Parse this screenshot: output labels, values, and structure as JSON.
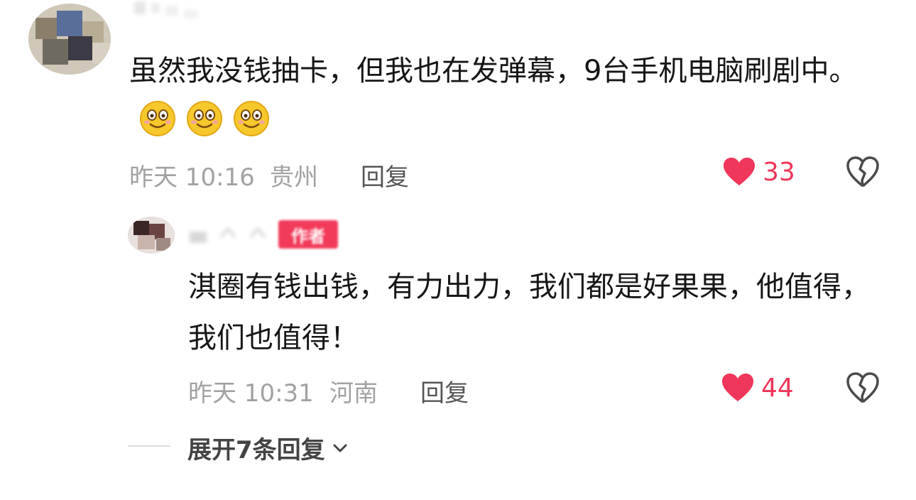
{
  "comments": [
    {
      "text": "虽然我没钱抽卡，但我也在发弹幕，9台手机电脑刷剧中。",
      "emoji_count": 3,
      "time": "昨天 10:16",
      "location": "贵州",
      "reply_label": "回复",
      "likes": "33"
    }
  ],
  "reply": {
    "badge": "作者",
    "text": "淇圈有钱出钱，有力出力，我们都是好果果，他值得，我们也值得！",
    "time": "昨天 10:31",
    "location": "河南",
    "reply_label": "回复",
    "likes": "44"
  },
  "expand": {
    "label": "展开7条回复"
  },
  "colors": {
    "like_red": "#f0365a",
    "meta_gray": "#a2a2a2",
    "text": "#161616"
  },
  "icons": {
    "heart": "heart-icon",
    "dislike": "broken-heart-icon",
    "chevron": "chevron-down-icon",
    "emoji": "smile-emoji"
  }
}
